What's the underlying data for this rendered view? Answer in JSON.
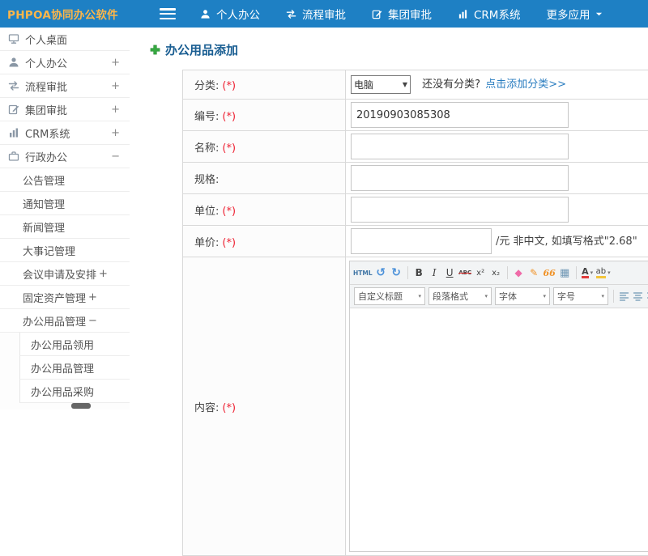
{
  "app": {
    "title": "PHPOA协同办公软件"
  },
  "topnav": {
    "items": [
      {
        "label": "个人办公",
        "icon": "user-icon"
      },
      {
        "label": "流程审批",
        "icon": "flow-icon"
      },
      {
        "label": "集团审批",
        "icon": "edit-icon"
      },
      {
        "label": "CRM系统",
        "icon": "chart-icon"
      },
      {
        "label": "更多应用",
        "icon": "caret-down-icon"
      }
    ]
  },
  "sidebar": {
    "items": [
      {
        "label": "个人桌面",
        "icon": "desktop-icon",
        "suffix": ""
      },
      {
        "label": "个人办公",
        "icon": "user-icon",
        "suffix": "+"
      },
      {
        "label": "流程审批",
        "icon": "flow-icon",
        "suffix": "+"
      },
      {
        "label": "集团审批",
        "icon": "edit-icon",
        "suffix": "+"
      },
      {
        "label": "CRM系统",
        "icon": "chart-icon",
        "suffix": "+"
      },
      {
        "label": "行政办公",
        "icon": "briefcase-icon",
        "suffix": "−"
      },
      {
        "label": "公告管理",
        "suffix": ""
      },
      {
        "label": "通知管理",
        "suffix": ""
      },
      {
        "label": "新闻管理",
        "suffix": ""
      },
      {
        "label": "大事记管理",
        "suffix": ""
      },
      {
        "label": "会议申请及安排",
        "suffix": "+"
      },
      {
        "label": "固定资产管理",
        "suffix": "+"
      },
      {
        "label": "办公用品管理",
        "suffix": "−"
      },
      {
        "label": "办公用品领用",
        "suffix": ""
      },
      {
        "label": "办公用品管理",
        "suffix": ""
      },
      {
        "label": "办公用品采购",
        "suffix": ""
      }
    ]
  },
  "page": {
    "title": "办公用品添加"
  },
  "form": {
    "category": {
      "label": "分类:",
      "required": "(*)",
      "value": "电脑",
      "hint": "还没有分类?",
      "link": "点击添加分类>>"
    },
    "code": {
      "label": "编号:",
      "required": "(*)",
      "value": "20190903085308"
    },
    "name": {
      "label": "名称:",
      "required": "(*)",
      "value": ""
    },
    "spec": {
      "label": "规格:",
      "required": "",
      "value": ""
    },
    "unit": {
      "label": "单位:",
      "required": "(*)",
      "value": ""
    },
    "price": {
      "label": "单价:",
      "required": "(*)",
      "value": "",
      "suffix": "/元 非中文, 如填写格式\"2.68\""
    },
    "content": {
      "label": "内容:",
      "required": "(*)"
    }
  },
  "editor": {
    "tools": {
      "html": "HTML",
      "undo": "↺",
      "redo": "↻",
      "bold": "B",
      "italic": "I",
      "underline": "U",
      "strike": "ABC",
      "superscript": "x²",
      "subscript": "x₂",
      "eraser": "◆",
      "format_brush": "✎",
      "blockquote": "66",
      "image": "▦",
      "font_color": "A",
      "back_color": "ab"
    },
    "dropdowns": [
      {
        "label": "自定义标题"
      },
      {
        "label": "段落格式"
      },
      {
        "label": "字体"
      },
      {
        "label": "字号"
      }
    ]
  }
}
